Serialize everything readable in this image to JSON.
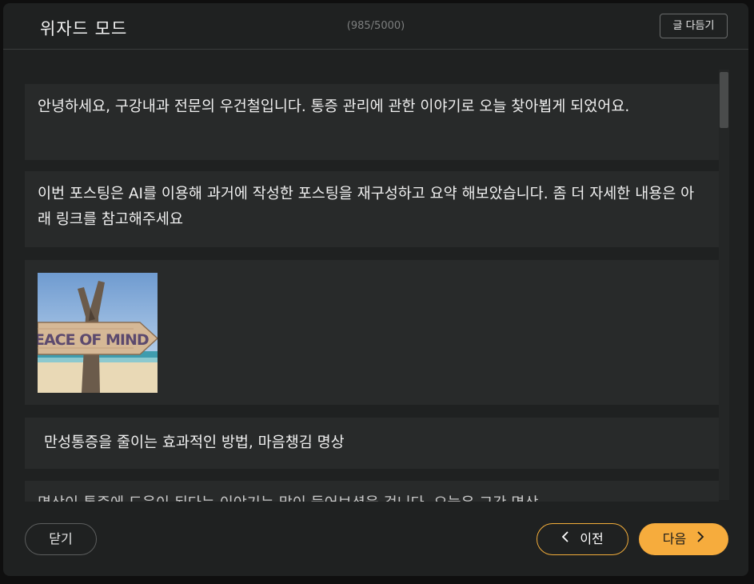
{
  "header": {
    "title": "위자드 모드",
    "counter": "(985/5000)",
    "tidy_label": "글 다듬기"
  },
  "blocks": [
    {
      "text": "안녕하세요, 구강내과 전문의 우건철입니다. 통증 관리에 관한 이야기로 오늘 찾아뵙게 되었어요."
    },
    {
      "text": "이번 포스팅은 AI를 이용해 과거에 작성한 포스팅을 재구성하고 요약 해보았습니다. 좀 더 자세한 내용은 아래 링크를 참고해주세요"
    },
    {
      "image_text": "EACE OF MIND"
    },
    {
      "text": "만성통증을 줄이는 효과적인 방법, 마음챙김 명상"
    },
    {
      "text": "명상이 통증에 도움이 된다는 이야기는 많이 들어보셨을 겁니다. 오늘은 그간 명상"
    }
  ],
  "footer": {
    "close_label": "닫기",
    "prev_label": "이전",
    "next_label": "다음"
  },
  "colors": {
    "accent": "#f6ac3d",
    "panel": "#1f2121",
    "block": "#282a2a"
  }
}
